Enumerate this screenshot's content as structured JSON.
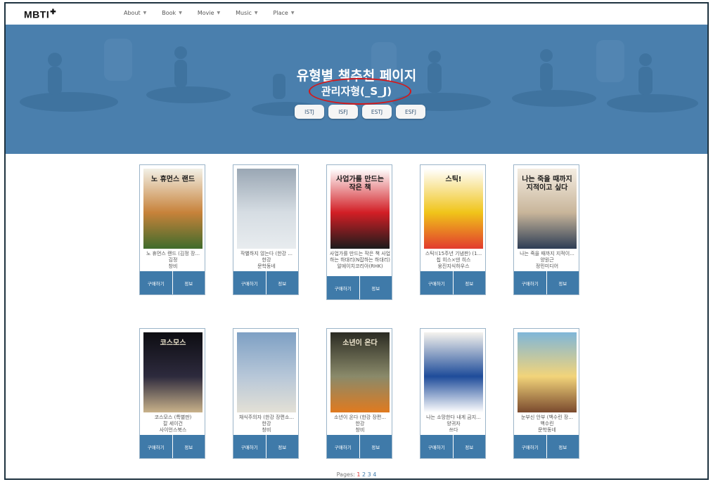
{
  "nav": {
    "logo": "MBTI",
    "logo_mark": "✚",
    "items": [
      {
        "label": "About"
      },
      {
        "label": "Book"
      },
      {
        "label": "Movie"
      },
      {
        "label": "Music"
      },
      {
        "label": "Place"
      }
    ]
  },
  "hero": {
    "title": "유형별 책추천 페이지",
    "subtitle": "관리자형(_S_J)",
    "buttons": [
      "ISTJ",
      "ISFJ",
      "ESTJ",
      "ESFJ"
    ]
  },
  "actions": {
    "buy": "구매하기",
    "info": "정보"
  },
  "books": [
    {
      "title": "노 휴먼스 랜드 (김정 장...",
      "author": "김정",
      "publisher": "창비",
      "cover_text": "노 휴먼스 랜드",
      "cover_colors": [
        "#f2f0e6",
        "#c7823a",
        "#3f6b2c"
      ]
    },
    {
      "title": "작별하지 않는다 (한강 ...",
      "author": "한강",
      "publisher": "문학동네",
      "cover_text": "",
      "cover_colors": [
        "#9aa7b4",
        "#d6dde3",
        "#e8ecef"
      ]
    },
    {
      "title": "사업가를 만드는 작은 책 사업하는 하대리(N잡하는 하대리)",
      "author": "",
      "publisher": "알에이치코리아(RHK)",
      "cover_text": "사업가를 만드는 작은 책",
      "cover_colors": [
        "#ffffff",
        "#d21e25",
        "#1b1b1b"
      ]
    },
    {
      "title": "스틱!(15주년 기념판) (1...",
      "author": "칩 히스×댄 히스",
      "publisher": "웅진지식하우스",
      "cover_text": "스틱!",
      "cover_colors": [
        "#ffffff",
        "#f0c419",
        "#e23b2e"
      ]
    },
    {
      "title": "나는 죽을 때까지 지적이...",
      "author": "양원근",
      "publisher": "정민미디어",
      "cover_text": "나는 죽을 때까지 지적이고 싶다",
      "cover_colors": [
        "#f4ede2",
        "#c8b59a",
        "#2d3d55"
      ]
    },
    {
      "title": "코스모스 (특별판)",
      "author": "칼 세이건",
      "publisher": "사이언스북스",
      "cover_text": "코스모스",
      "cover_colors": [
        "#0d0d12",
        "#2d2a3d",
        "#c9b28a"
      ]
    },
    {
      "title": "채식주의자 (한강 장편소...",
      "author": "한강",
      "publisher": "창비",
      "cover_text": "",
      "cover_colors": [
        "#7ea0c4",
        "#b7c7d8",
        "#e3e0d6"
      ]
    },
    {
      "title": "소년이 온다 (한강 장편...",
      "author": "한강",
      "publisher": "창비",
      "cover_text": "소년이 온다",
      "cover_colors": [
        "#2b2b23",
        "#8a8a6a",
        "#e07a1f"
      ]
    },
    {
      "title": "나는 소망한다 내게 금지...",
      "author": "양귀자",
      "publisher": "쓰다",
      "cover_text": "",
      "cover_colors": [
        "#f5f3ee",
        "#1e4c9a",
        "#ffffff"
      ]
    },
    {
      "title": "눈부신 안부 (백수린 장...",
      "author": "백수린",
      "publisher": "문학동네",
      "cover_text": "",
      "cover_colors": [
        "#7fb6d9",
        "#f2d47a",
        "#7a4a2e"
      ]
    }
  ],
  "pagination": {
    "label": "Pages:",
    "current": "1",
    "pages": [
      "2",
      "3",
      "4"
    ]
  }
}
